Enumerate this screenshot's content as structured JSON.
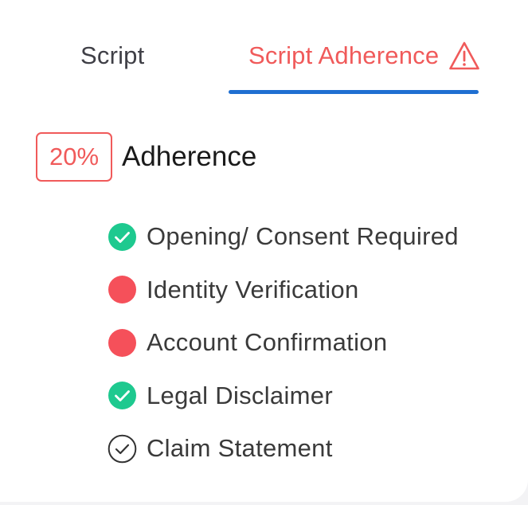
{
  "tabs": [
    {
      "label": "Script",
      "active": false
    },
    {
      "label": "Script Adherence",
      "active": true,
      "icon": "warning-triangle-icon"
    }
  ],
  "adherence": {
    "percent_label": "20%",
    "label": "Adherence"
  },
  "checklist": [
    {
      "label": "Opening/ Consent Required",
      "status": "passed",
      "icon": "check-circle-filled-icon"
    },
    {
      "label": "Identity Verification",
      "status": "failed",
      "icon": "red-dot-icon"
    },
    {
      "label": "Account Confirmation",
      "status": "failed",
      "icon": "red-dot-icon"
    },
    {
      "label": "Legal Disclaimer",
      "status": "passed",
      "icon": "check-circle-filled-icon"
    },
    {
      "label": "Claim Statement",
      "status": "pending",
      "icon": "check-circle-outline-icon"
    }
  ],
  "colors": {
    "accent_red": "#f05a5a",
    "tab_underline_blue": "#1f6fd1",
    "pass_green": "#1ec98f",
    "fail_red": "#f5505a",
    "pending_gray": "#333333"
  }
}
